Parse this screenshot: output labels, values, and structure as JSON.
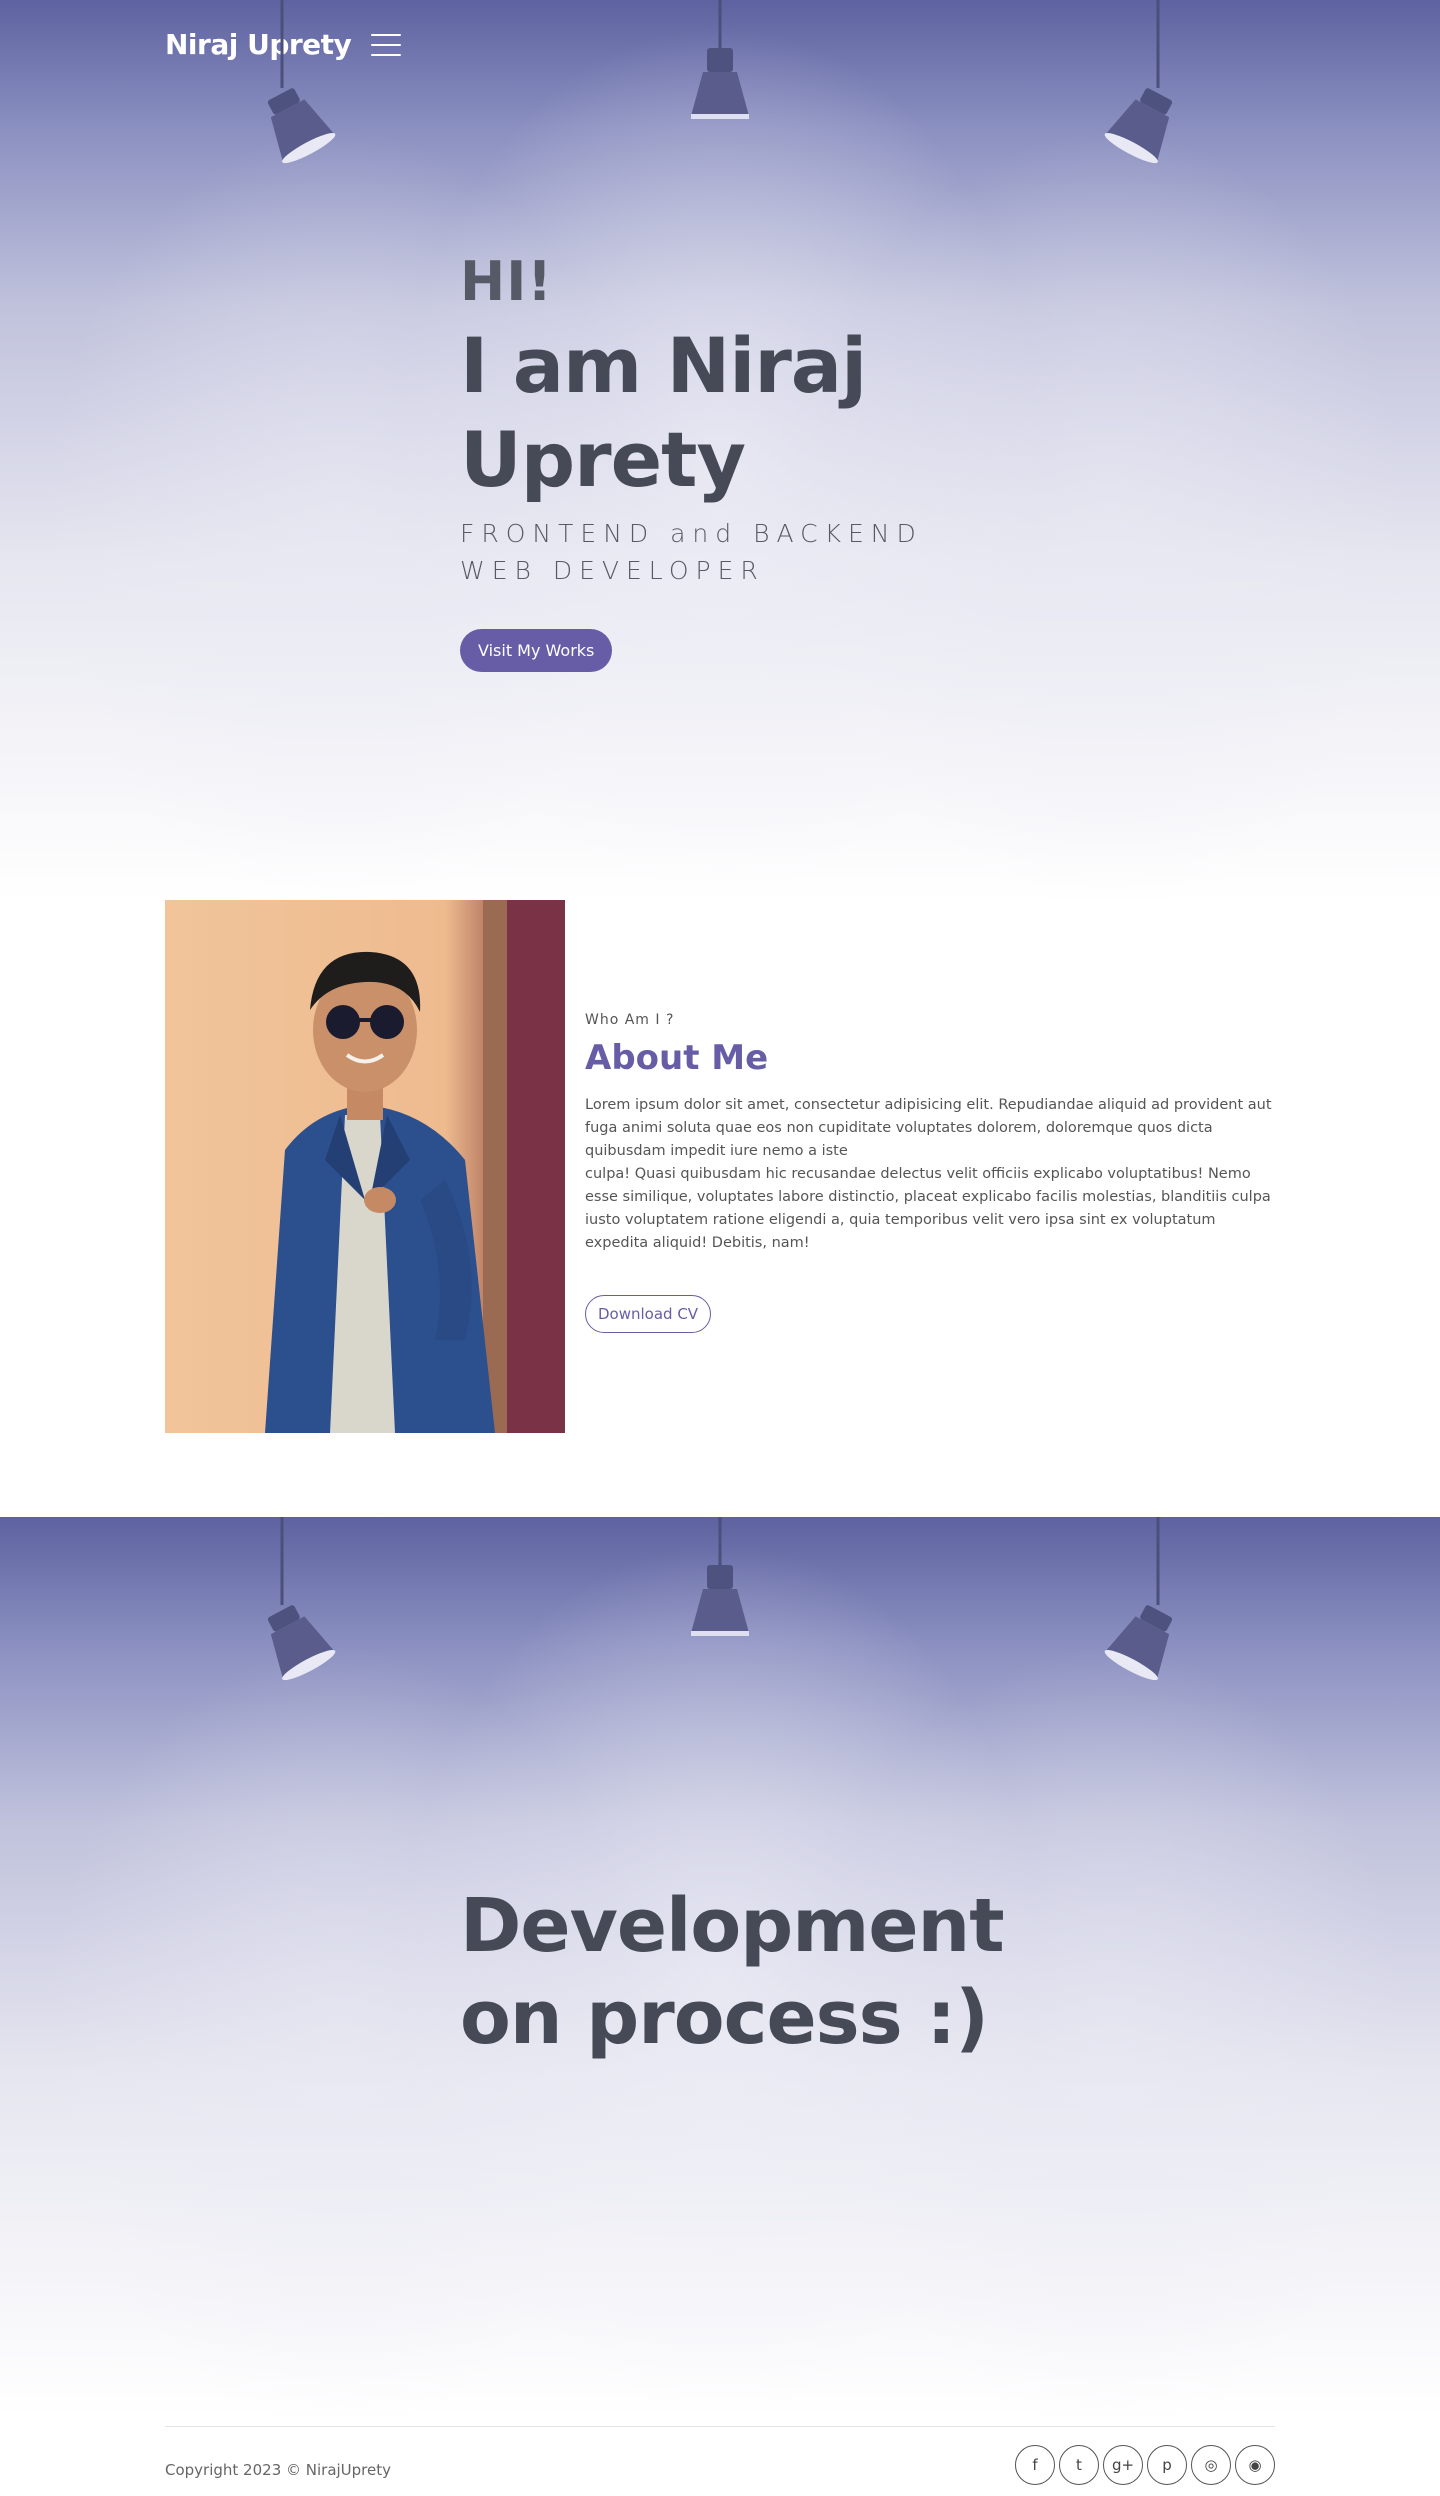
{
  "nav": {
    "brand": "Niraj Uprety",
    "menu_icon": "hamburger-menu-icon"
  },
  "hero": {
    "greeting": "HI!",
    "name_line1": "I am Niraj",
    "name_line2": "Uprety",
    "role_line1": "FRONTEND and BACKEND",
    "role_line2": "WEB DEVELOPER",
    "button_label": "Visit My Works",
    "button_color": "#675da7"
  },
  "about": {
    "photo_alt": "Niraj Uprety portrait",
    "eyebrow": "Who Am I ?",
    "title": "About Me",
    "paragraph": "Lorem ipsum dolor sit amet, consectetur adipisicing elit. Repudiandae aliquid ad provident aut fuga animi soluta quae eos non cupiditate voluptates dolorem, doloremque quos dicta quibusdam impedit iure nemo a iste\nculpa! Quasi quibusdam hic recusandae delectus velit officiis explicabo voluptatibus! Nemo esse similique, voluptates labore distinctio, placeat explicabo facilis molestias, blanditiis culpa iusto voluptatem ratione eligendi a, quia temporibus velit vero ipsa sint ex voluptatum expedita aliquid! Debitis, nam!",
    "cv_button": "Download CV"
  },
  "dev": {
    "line1": "Development",
    "line2": "on process :)"
  },
  "footer": {
    "copyright": "Copyright 2023 © NirajUprety",
    "socials": [
      {
        "icon": "facebook-icon",
        "glyph": "f"
      },
      {
        "icon": "twitter-icon",
        "glyph": "t"
      },
      {
        "icon": "google-plus-icon",
        "glyph": "g+"
      },
      {
        "icon": "pinterest-icon",
        "glyph": "p"
      },
      {
        "icon": "instagram-icon",
        "glyph": "◎"
      },
      {
        "icon": "rss-icon",
        "glyph": "◉"
      }
    ]
  }
}
